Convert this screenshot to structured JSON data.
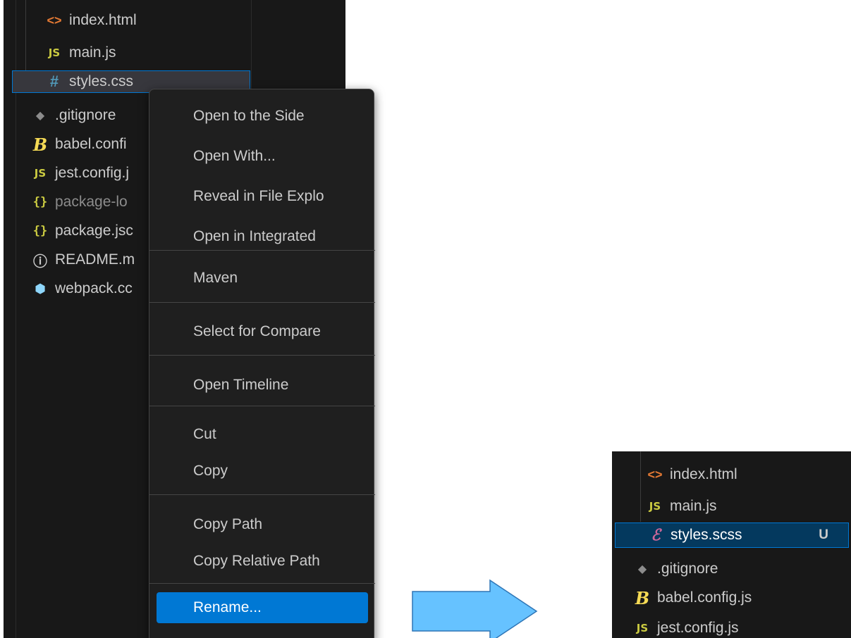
{
  "explorer_before": {
    "files": [
      {
        "name": "index.html",
        "icon": "html-icon"
      },
      {
        "name": "main.js",
        "icon": "js-icon"
      },
      {
        "name": "styles.css",
        "icon": "css-hash-icon",
        "selected": true
      },
      {
        "name": ".gitignore",
        "icon": "git-icon"
      },
      {
        "name": "babel.confi",
        "icon": "babel-icon"
      },
      {
        "name": "jest.config.j",
        "icon": "js-icon"
      },
      {
        "name": "package-lo",
        "icon": "json-icon",
        "dimmed": true
      },
      {
        "name": "package.jsc",
        "icon": "json-icon"
      },
      {
        "name": "README.m",
        "icon": "info-icon"
      },
      {
        "name": "webpack.cc",
        "icon": "webpack-icon"
      }
    ]
  },
  "icons": {
    "html": "<>",
    "js": "JS",
    "css": "#",
    "git": "◆",
    "babel": "B",
    "json": "{}",
    "info": "ⓘ",
    "webpack": "⬢",
    "sass": "ℰ"
  },
  "context_menu": {
    "items": [
      "Open to the Side",
      "Open With...",
      "Reveal in File Explo",
      "Open in Integrated",
      "Maven",
      "Select for Compare",
      "Open Timeline",
      "Cut",
      "Copy",
      "Copy Path",
      "Copy Relative Path",
      "Rename..."
    ],
    "active_item": "Rename..."
  },
  "explorer_after": {
    "files": [
      {
        "name": "index.html",
        "icon": "html-icon"
      },
      {
        "name": "main.js",
        "icon": "js-icon"
      },
      {
        "name": "styles.scss",
        "icon": "sass-icon",
        "selected": true,
        "badge": "U"
      },
      {
        "name": ".gitignore",
        "icon": "git-icon"
      },
      {
        "name": "babel.config.js",
        "icon": "babel-icon"
      },
      {
        "name": "jest.config.js",
        "icon": "js-icon"
      }
    ]
  },
  "colors": {
    "panel_bg": "#181818",
    "menu_bg": "#1f1f1f",
    "accent": "#0078d4",
    "arrow_fill": "#66c2ff",
    "arrow_stroke": "#2e75b6"
  }
}
